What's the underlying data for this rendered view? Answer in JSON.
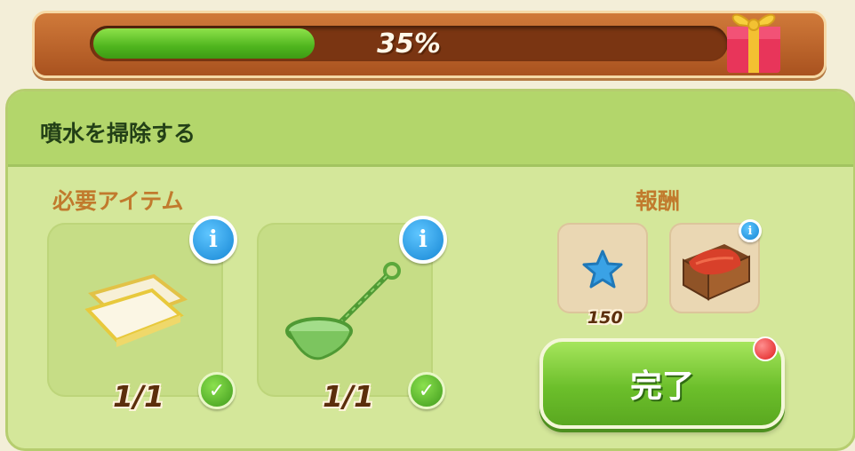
{
  "progress": {
    "percent": 35,
    "label": "35%"
  },
  "task": {
    "title": "噴水を掃除する"
  },
  "required": {
    "label": "必要アイテム",
    "items": [
      {
        "icon": "cloth-icon",
        "count": "1/1",
        "complete": true
      },
      {
        "icon": "fishing-net-icon",
        "count": "1/1",
        "complete": true
      }
    ]
  },
  "reward": {
    "label": "報酬",
    "items": [
      {
        "icon": "blue-star-icon",
        "amount": "150"
      },
      {
        "icon": "crate-icon"
      }
    ]
  },
  "complete_button": {
    "label": "完了"
  },
  "colors": {
    "progress_fill": "#5cc022",
    "panel_bg": "#d4e79a",
    "header_bg": "#b3d66b",
    "label_orange": "#c17a2d",
    "info_blue": "#1686d4"
  }
}
